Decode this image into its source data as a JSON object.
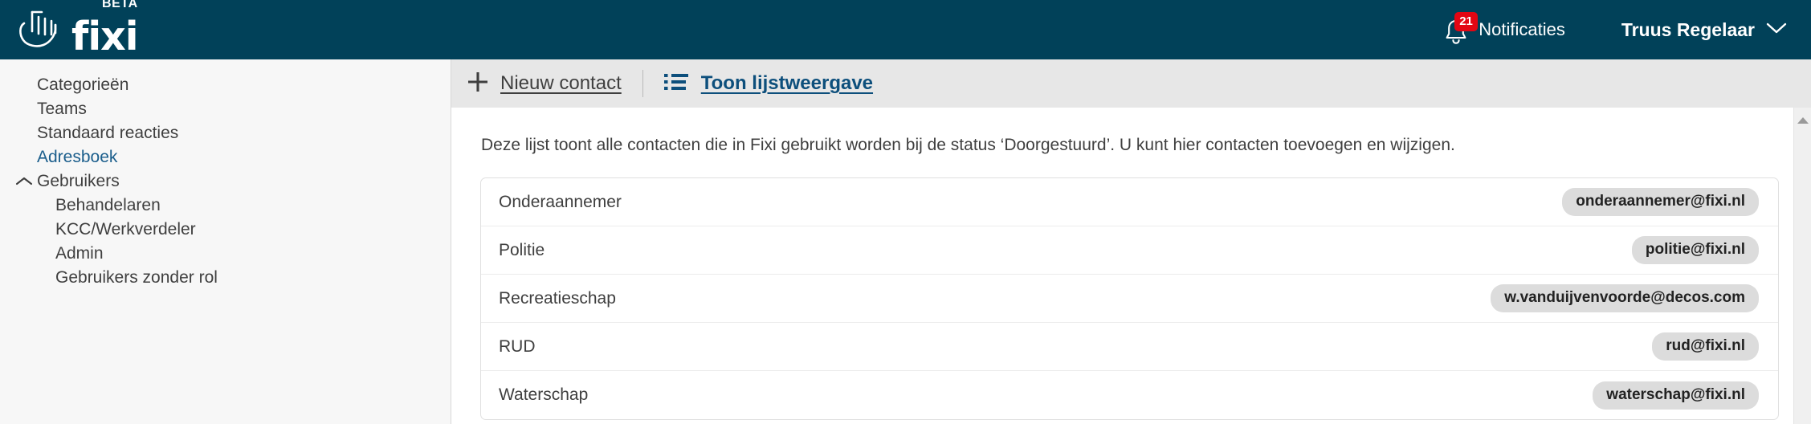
{
  "colors": {
    "header_bg": "#014159",
    "toolbar_bg": "#e7e7e7",
    "sidebar_bg": "#f7f7f7",
    "accent_link": "#0d4f7c",
    "active_nav": "#1b5e8c",
    "badge_red": "#e30613",
    "pill_bg": "#dcdcdc",
    "text": "#3f3f3f"
  },
  "header": {
    "brand": {
      "wordmark": "fixi",
      "beta_tag": "BETA",
      "hand_icon": "hand-logo-icon"
    },
    "notifications": {
      "icon": "bell-icon",
      "count": "21",
      "label": "Notificaties"
    },
    "user": {
      "name": "Truus Regelaar",
      "chevron_icon": "chevron-down-icon"
    }
  },
  "sidebar": {
    "items": [
      {
        "label": "Categorieën",
        "level": 1,
        "active": false,
        "caret": null
      },
      {
        "label": "Teams",
        "level": 1,
        "active": false,
        "caret": null
      },
      {
        "label": "Standaard reacties",
        "level": 1,
        "active": false,
        "caret": null
      },
      {
        "label": "Adresboek",
        "level": 1,
        "active": true,
        "caret": null
      },
      {
        "label": "Gebruikers",
        "level": 1,
        "active": false,
        "caret": "chevron-up-icon"
      },
      {
        "label": "Behandelaren",
        "level": 2,
        "active": false,
        "caret": null
      },
      {
        "label": "KCC/Werkverdeler",
        "level": 2,
        "active": false,
        "caret": null
      },
      {
        "label": "Admin",
        "level": 2,
        "active": false,
        "caret": null
      },
      {
        "label": "Gebruikers zonder rol",
        "level": 2,
        "active": false,
        "caret": null
      }
    ]
  },
  "toolbar": {
    "new_contact_label": "Nieuw contact",
    "new_contact_icon": "plus-icon",
    "list_view_label": "Toon lijstweergave",
    "list_view_icon": "list-view-icon"
  },
  "main": {
    "description": "Deze lijst toont alle contacten die in Fixi gebruikt worden bij de status ‘Doorgestuurd’. U kunt hier contacten toevoegen en wijzigen.",
    "contacts": [
      {
        "name": "Onderaannemer",
        "email": "onderaannemer@fixi.nl"
      },
      {
        "name": "Politie",
        "email": "politie@fixi.nl"
      },
      {
        "name": "Recreatieschap",
        "email": "w.vanduijvenvoorde@decos.com"
      },
      {
        "name": "RUD",
        "email": "rud@fixi.nl"
      },
      {
        "name": "Waterschap",
        "email": "waterschap@fixi.nl"
      }
    ]
  },
  "scrollbar": {
    "up_arrow_icon": "scroll-up-arrow-icon"
  }
}
